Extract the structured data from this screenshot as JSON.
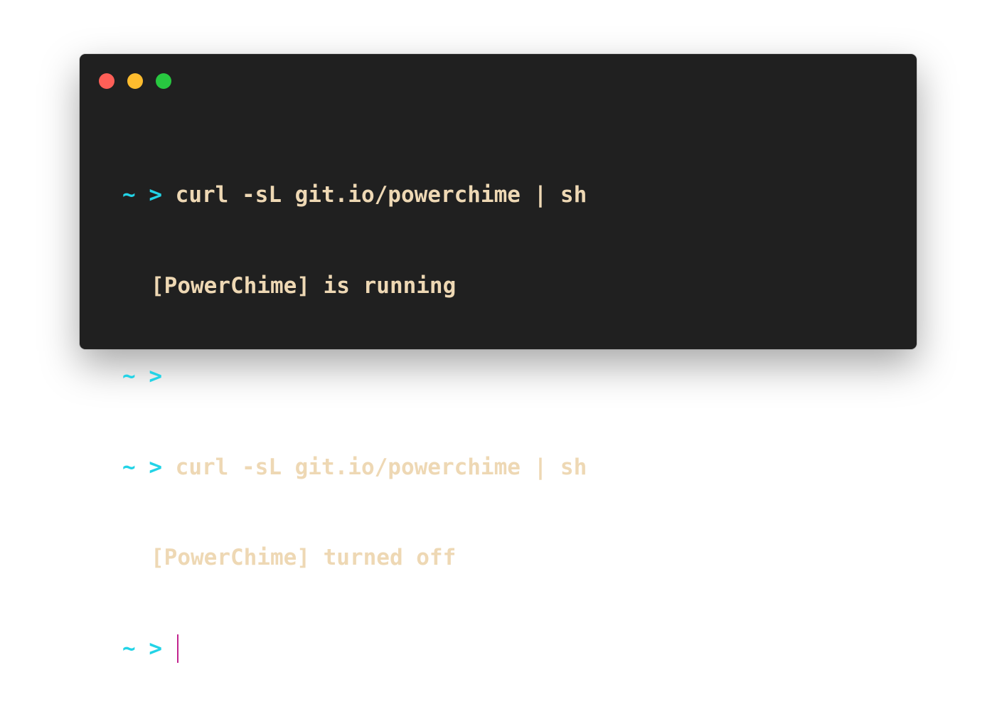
{
  "window": {
    "traffic_lights": [
      {
        "name": "close",
        "color": "#fe5f57"
      },
      {
        "name": "minimize",
        "color": "#febc2e"
      },
      {
        "name": "maximize",
        "color": "#28c840"
      }
    ]
  },
  "colors": {
    "background": "#202020",
    "prompt": "#22d3e6",
    "text": "#eed8b4",
    "cursor": "#c2258e"
  },
  "terminal": {
    "prompt_symbol": "~ >",
    "lines": [
      {
        "type": "command",
        "prompt": "~ >",
        "text": "curl -sL git.io/powerchime | sh"
      },
      {
        "type": "output",
        "text": "[PowerChime] is running"
      },
      {
        "type": "command",
        "prompt": "~ >",
        "text": ""
      },
      {
        "type": "command",
        "prompt": "~ >",
        "text": "curl -sL git.io/powerchime | sh"
      },
      {
        "type": "output",
        "text": "[PowerChime] turned off"
      },
      {
        "type": "command",
        "prompt": "~ >",
        "text": ""
      }
    ]
  }
}
